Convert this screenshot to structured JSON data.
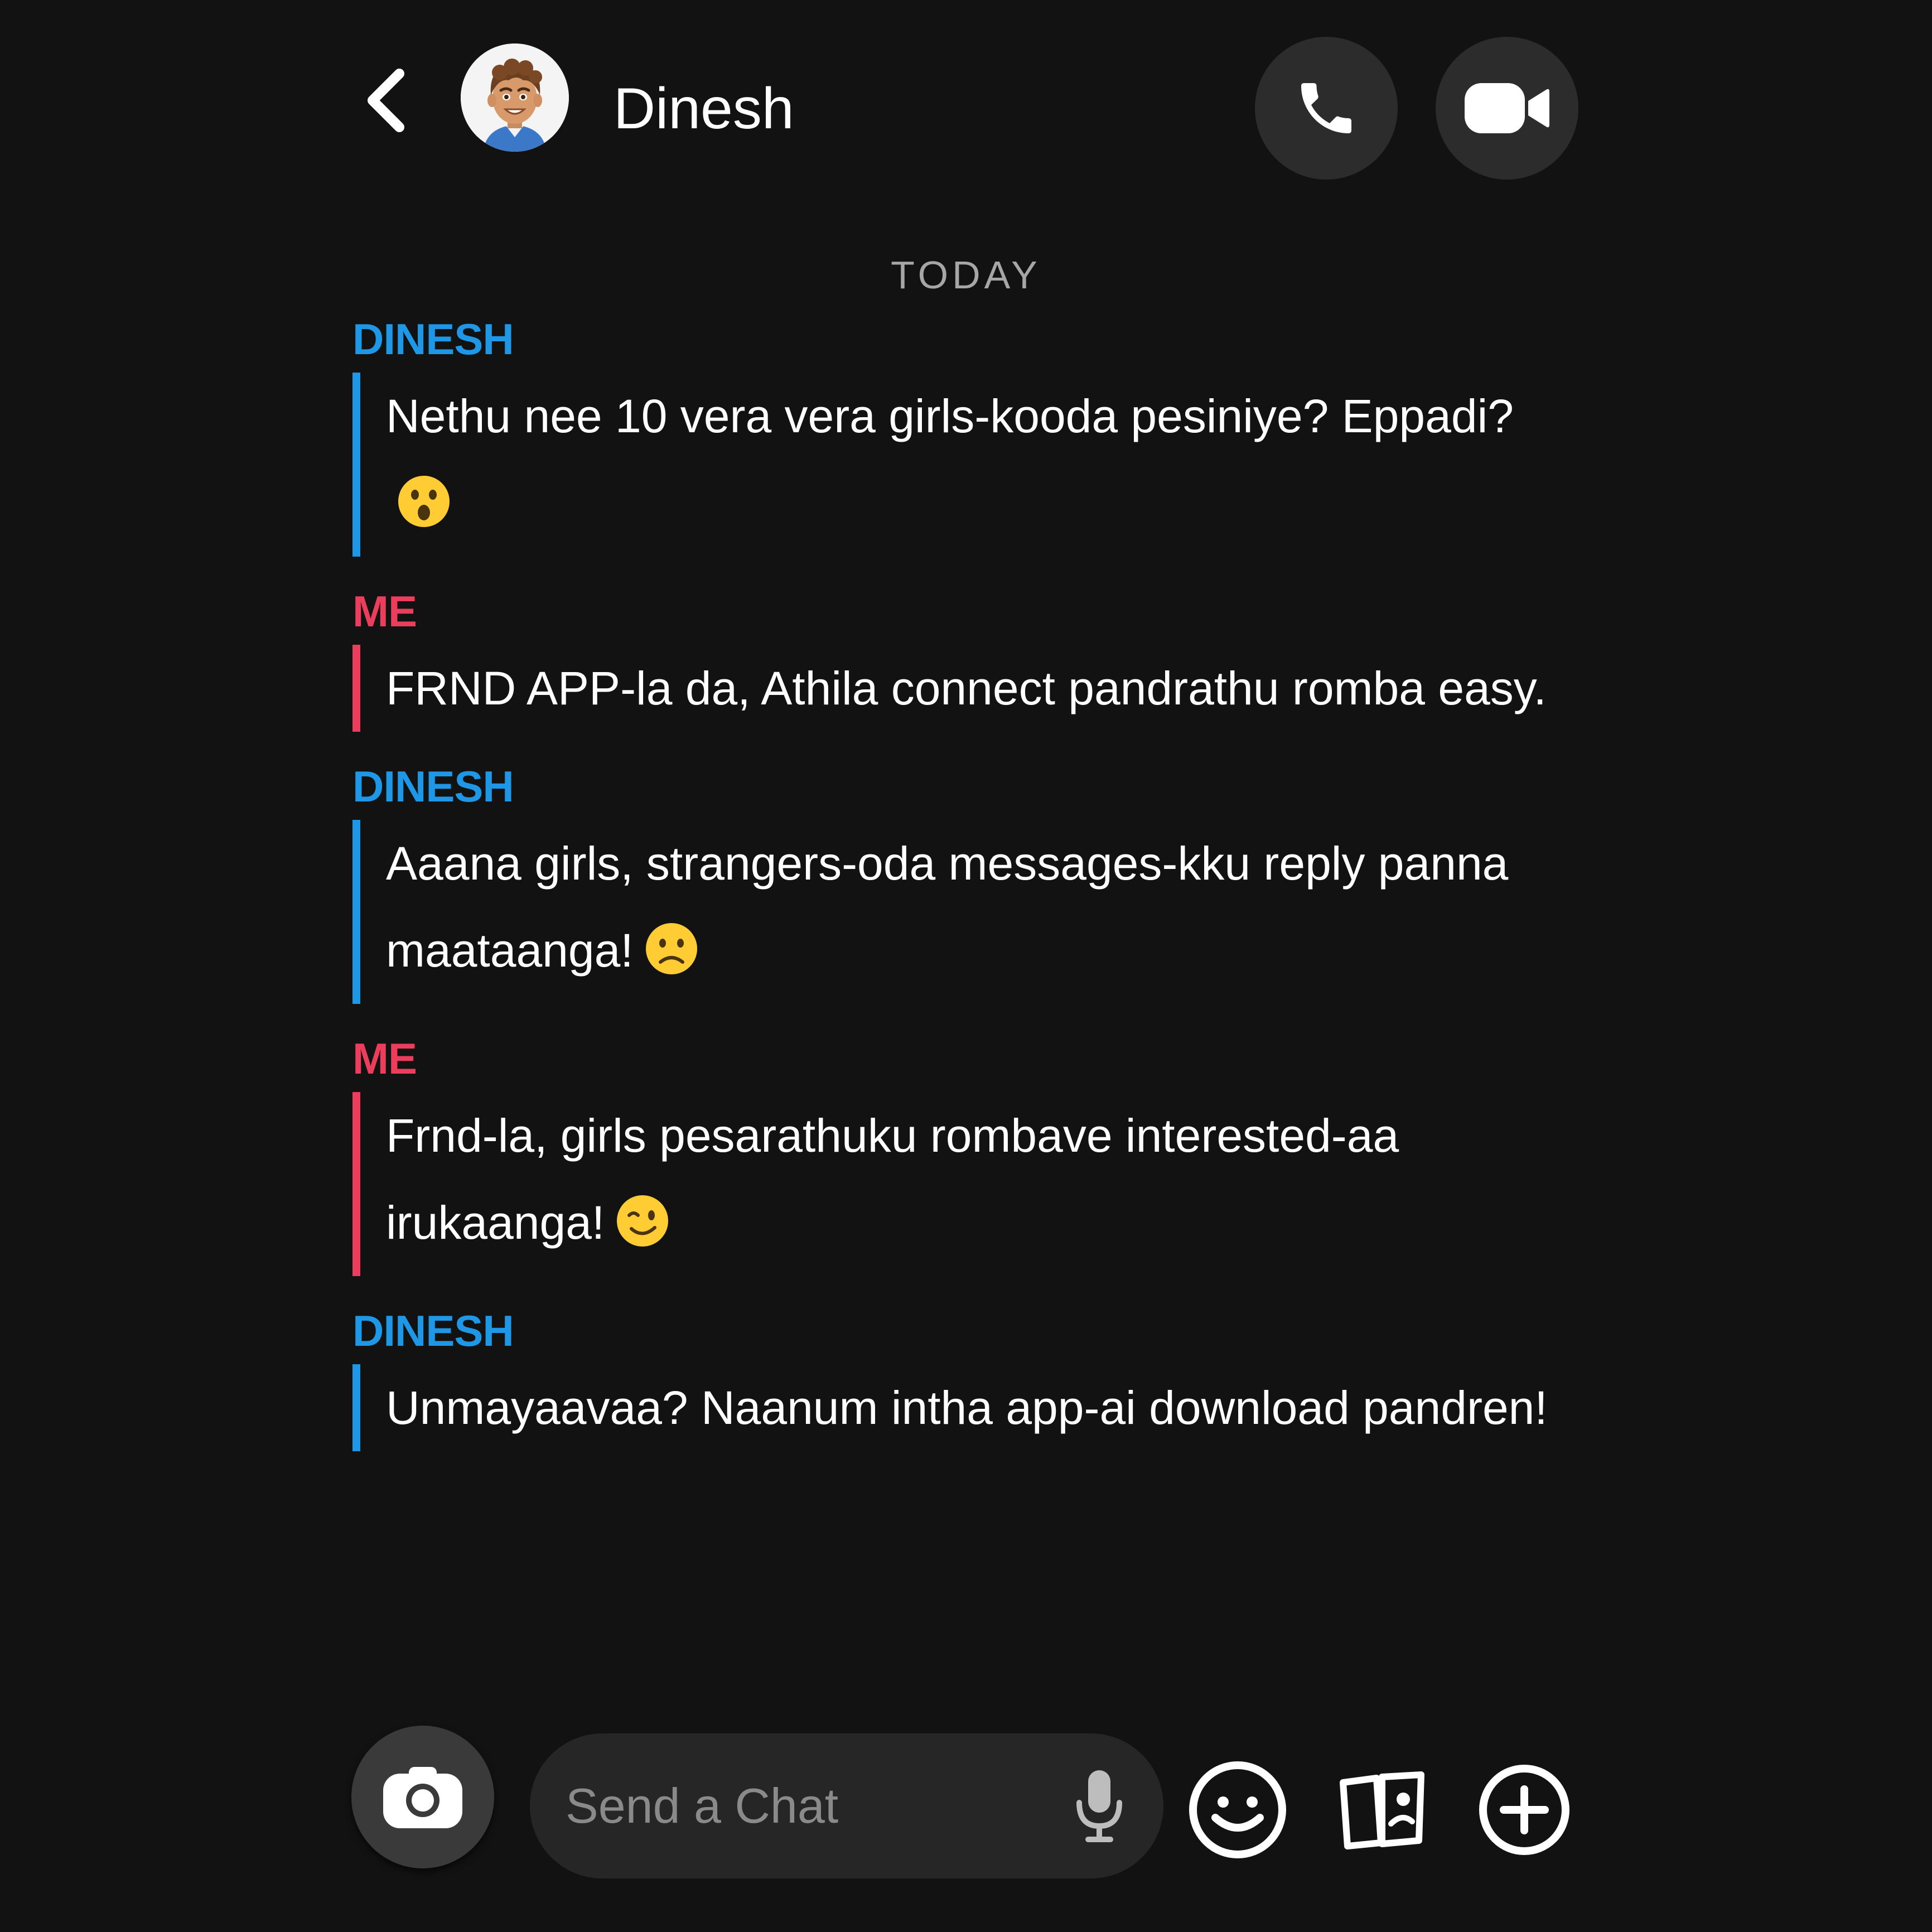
{
  "header": {
    "contact_name": "Dinesh",
    "back_icon": "chevron-left-icon",
    "avatar_icon": "bitmoji-avatar",
    "call_icon": "phone-icon",
    "video_icon": "video-camera-icon"
  },
  "chat": {
    "date_label": "TODAY",
    "messages": [
      {
        "sender": "DINESH",
        "from": "them",
        "text": "Nethu nee 10 vera vera girls-kooda pesiniye? Eppadi?",
        "emoji": "astonished-face-emoji"
      },
      {
        "sender": "ME",
        "from": "me",
        "text": "FRND APP-la da, Athila connect pandrathu romba easy.",
        "emoji": ""
      },
      {
        "sender": "DINESH",
        "from": "them",
        "text": "Aaana girls, strangers-oda messages-kku reply panna maataanga!",
        "emoji": "slightly-frowning-face-emoji"
      },
      {
        "sender": "ME",
        "from": "me",
        "text": "Frnd-la, girls pesarathuku rombave interested-aa irukaanga!",
        "emoji": "winking-face-emoji"
      },
      {
        "sender": "DINESH",
        "from": "them",
        "text": "Unmayaavaa? Naanum intha app-ai download pandren!",
        "emoji": ""
      }
    ]
  },
  "composer": {
    "placeholder": "Send a Chat",
    "value": "",
    "camera_icon": "camera-icon",
    "mic_icon": "microphone-icon",
    "emoji_icon": "smiley-icon",
    "stickers_icon": "stickers-cards-icon",
    "plus_icon": "plus-circle-icon"
  },
  "colors": {
    "background": "#121212",
    "them_accent": "#1e97e6",
    "me_accent": "#ec3d5c",
    "button_bg": "#2c2c2c",
    "input_bg": "#262626"
  }
}
